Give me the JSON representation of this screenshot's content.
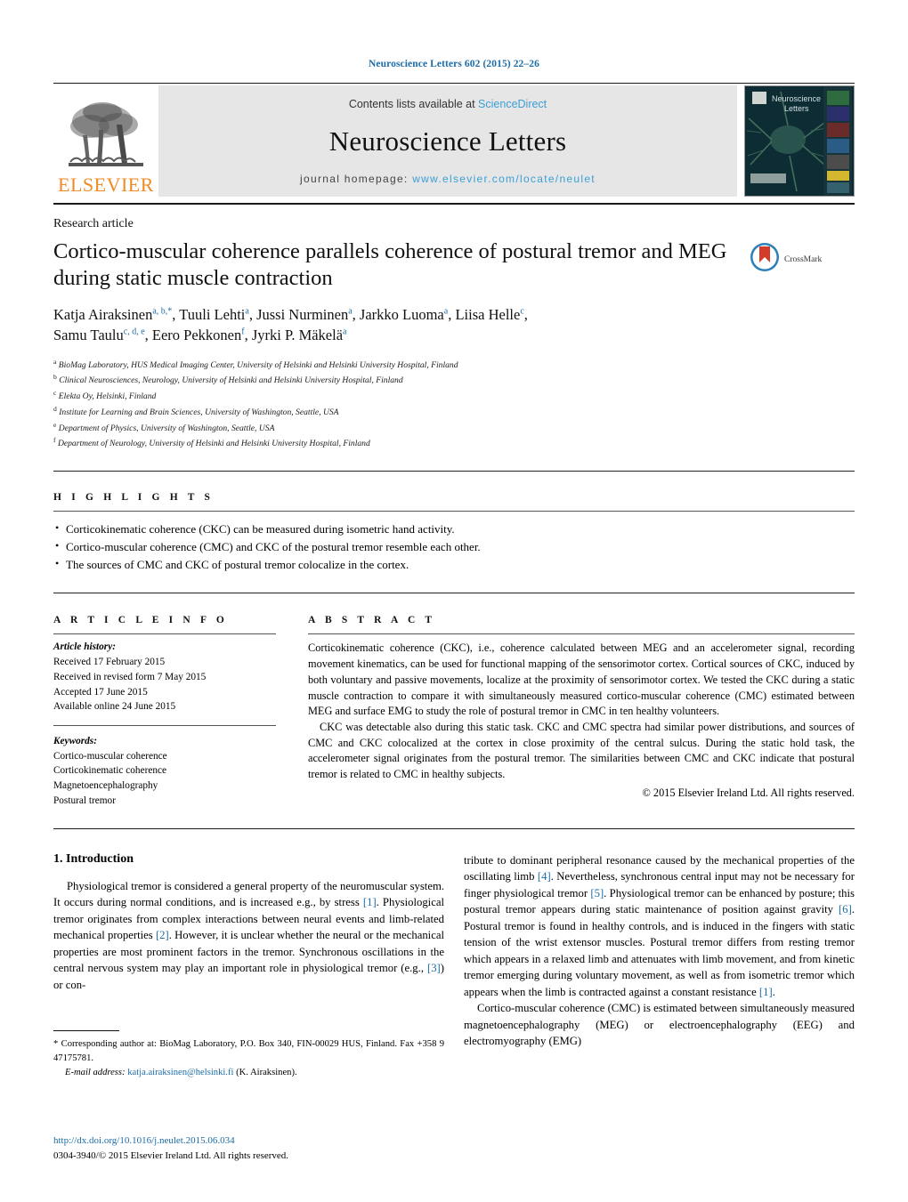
{
  "running_head": "Neuroscience Letters 602 (2015) 22–26",
  "masthead": {
    "contents_prefix": "Contents lists available at ",
    "sciencedirect": "ScienceDirect",
    "journal_title": "Neuroscience Letters",
    "homepage_prefix": "journal homepage: ",
    "homepage_url": "www.elsevier.com/locate/neulet",
    "publisher_logo_text": "ELSEVIER",
    "cover_title_line1": "Neuroscience",
    "cover_title_line2": "Letters",
    "link_color": "#3a9fd4",
    "elsevier_orange": "#f08a24"
  },
  "article": {
    "type": "Research article",
    "title": "Cortico-muscular coherence parallels coherence of postural tremor and MEG during static muscle contraction",
    "crossmark_label": "CrossMark",
    "authors_line1": "Katja Airaksinen",
    "authors_line1_sup": "a, b,*",
    "authors_rest_1": ", Tuuli Lehti",
    "authors_rest_1_sup": "a",
    "authors_rest_2": ", Jussi Nurminen",
    "authors_rest_2_sup": "a",
    "authors_rest_3": ", Jarkko Luoma",
    "authors_rest_3_sup": "a",
    "authors_rest_4": ", Liisa Helle",
    "authors_rest_4_sup": "c",
    "authors_line2": "Samu Taulu",
    "authors_line2_sup": "c, d, e",
    "authors_rest_5": ", Eero Pekkonen",
    "authors_rest_5_sup": "f",
    "authors_rest_6": ", Jyrki P. Mäkelä",
    "authors_rest_6_sup": "a",
    "affiliations": [
      {
        "marker": "a",
        "text": "BioMag Laboratory, HUS Medical Imaging Center, University of Helsinki and Helsinki University Hospital, Finland"
      },
      {
        "marker": "b",
        "text": "Clinical Neurosciences, Neurology, University of Helsinki and Helsinki University Hospital, Finland"
      },
      {
        "marker": "c",
        "text": "Elekta Oy, Helsinki, Finland"
      },
      {
        "marker": "d",
        "text": "Institute for Learning and Brain Sciences, University of Washington, Seattle, USA"
      },
      {
        "marker": "e",
        "text": "Department of Physics, University of Washington, Seattle, USA"
      },
      {
        "marker": "f",
        "text": "Department of Neurology, University of Helsinki and Helsinki University Hospital, Finland"
      }
    ]
  },
  "highlights": {
    "label": "H I G H L I G H T S",
    "items": [
      "Corticokinematic coherence (CKC) can be measured during isometric hand activity.",
      "Cortico-muscular coherence (CMC) and CKC of the postural tremor resemble each other.",
      "The sources of CMC and CKC of postural tremor colocalize in the cortex."
    ]
  },
  "article_info": {
    "label": "A R T I C L E   I N F O",
    "history_head": "Article history:",
    "history": [
      "Received 17 February 2015",
      "Received in revised form 7 May 2015",
      "Accepted 17 June 2015",
      "Available online 24 June 2015"
    ],
    "keywords_head": "Keywords:",
    "keywords": [
      "Cortico-muscular coherence",
      "Corticokinematic coherence",
      "Magnetoencephalography",
      "Postural tremor"
    ]
  },
  "abstract": {
    "label": "A B S T R A C T",
    "paragraph1": "Corticokinematic coherence (CKC), i.e., coherence calculated between MEG and an accelerometer signal, recording movement kinematics, can be used for functional mapping of the sensorimotor cortex. Cortical sources of CKC, induced by both voluntary and passive movements, localize at the proximity of sensorimotor cortex. We tested the CKC during a static muscle contraction to compare it with simultaneously measured cortico-muscular coherence (CMC) estimated between MEG and surface EMG to study the role of postural tremor in CMC in ten healthy volunteers.",
    "paragraph2": "CKC was detectable also during this static task. CKC and CMC spectra had similar power distributions, and sources of CMC and CKC colocalized at the cortex in close proximity of the central sulcus. During the static hold task, the accelerometer signal originates from the postural tremor. The similarities between CMC and CKC indicate that postural tremor is related to CMC in healthy subjects.",
    "copyright": "© 2015 Elsevier Ireland Ltd. All rights reserved."
  },
  "body": {
    "section_number_title": "1.  Introduction",
    "left_paragraph_start": "Physiological tremor is considered a general property of the neuromuscular system. It occurs during normal conditions, and is increased e.g., by stress ",
    "ref1a": "[1]",
    "left_paragraph_mid1": ". Physiological tremor originates from complex interactions between neural events and limb-related mechanical properties ",
    "ref2": "[2]",
    "left_paragraph_mid2": ". However, it is unclear whether the neural or the mechanical properties are most prominent factors in the tremor. Synchronous oscillations in the central nervous system may play an important role in physiological tremor (e.g., ",
    "ref3": "[3]",
    "left_paragraph_end": ") or con-",
    "right_paragraph1_start": "tribute to dominant peripheral resonance caused by the mechanical properties of the oscillating limb ",
    "ref4": "[4]",
    "right_p1_mid1": ". Nevertheless, synchronous central input may not be necessary for finger physiological tremor ",
    "ref5": "[5]",
    "right_p1_mid2": ". Physiological tremor can be enhanced by posture; this postural tremor appears during static maintenance of position against gravity ",
    "ref6": "[6]",
    "right_p1_mid3": ". Postural tremor is found in healthy controls, and is induced in the fingers with static tension of the wrist extensor muscles. Postural tremor differs from resting tremor which appears in a relaxed limb and attenuates with limb movement, and from kinetic tremor emerging during voluntary movement, as well as from isometric tremor which appears when the limb is contracted against a constant resistance ",
    "ref1b": "[1]",
    "right_p1_end": ".",
    "right_paragraph2": "Cortico-muscular coherence (CMC) is estimated between simultaneously measured magnetoencephalography (MEG) or electroencephalography (EEG) and electromyography (EMG)"
  },
  "footnote": {
    "star": "*",
    "corresponding": "Corresponding author at: BioMag Laboratory, P.O. Box 340, FIN-00029 HUS, Finland. Fax +358 9 47175781.",
    "email_label": "E-mail address:",
    "email": "katja.airaksinen@helsinki.fi",
    "email_suffix": "(K. Airaksinen)."
  },
  "footer": {
    "doi": "http://dx.doi.org/10.1016/j.neulet.2015.06.034",
    "issn_line": "0304-3940/© 2015 Elsevier Ireland Ltd. All rights reserved."
  }
}
